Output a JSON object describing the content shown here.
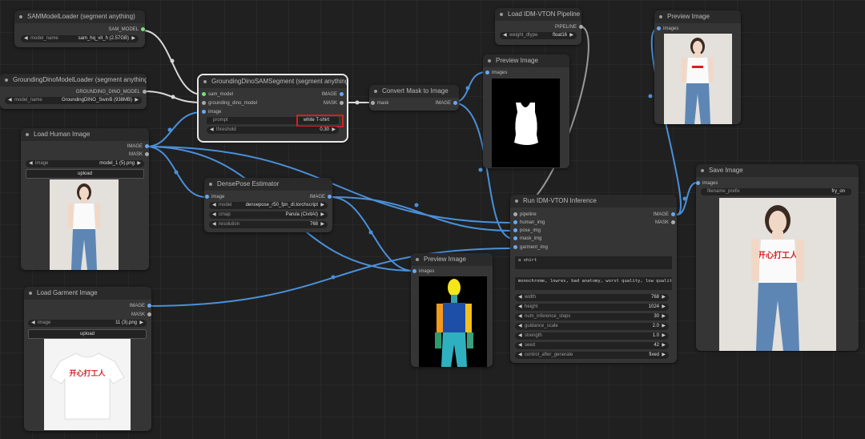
{
  "nodes": {
    "sam_loader": {
      "title": "SAMModelLoader (segment anything)",
      "out_label": "SAM_MODEL",
      "widget_label": "model_name",
      "widget_value": "sam_hq_vit_h (2.57GB)"
    },
    "gdino_loader": {
      "title": "GroundingDinoModelLoader (segment anything)",
      "out_label": "GROUNDING_DINO_MODEL",
      "widget_label": "model_name",
      "widget_value": "GroundingDINO_SwinB (938MB)"
    },
    "gdino_seg": {
      "title": "GroundingDinoSAMSegment (segment anything)",
      "in1": "sam_model",
      "in2": "grounding_dino_model",
      "in3": "image",
      "out1": "IMAGE",
      "out2": "MASK",
      "prompt_label": "prompt",
      "prompt_value": "white T-shirt",
      "threshold_label": "threshold",
      "threshold_value": "0.30"
    },
    "convert_mask": {
      "title": "Convert Mask to Image",
      "in1": "mask",
      "out1": "IMAGE"
    },
    "load_idm": {
      "title": "Load IDM-VTON Pipeline",
      "out1": "PIPELINE",
      "widget_label": "weight_dtype",
      "widget_value": "float16"
    },
    "preview1": {
      "title": "Preview Image",
      "in1": "images"
    },
    "preview_top": {
      "title": "Preview Image",
      "in1": "images"
    },
    "load_human": {
      "title": "Load Human Image",
      "out1": "IMAGE",
      "out2": "MASK",
      "widget_label": "image",
      "widget_value": "model_1 (5).png",
      "upload_label": "upload"
    },
    "densepose": {
      "title": "DensePose Estimator",
      "in1": "image",
      "out1": "IMAGE",
      "w1_label": "model",
      "w1_value": "densepose_r50_fpn_dl.torchscript",
      "w2_label": "cmap",
      "w2_value": "Parula (CivitAI)",
      "w3_label": "resolution",
      "w3_value": "768"
    },
    "run_idm": {
      "title": "Run IDM-VTON Inference",
      "in1": "pipeline",
      "in2": "human_img",
      "in3": "pose_img",
      "in4": "mask_img",
      "in5": "garment_img",
      "out1": "IMAGE",
      "out2": "MASK",
      "text1": "a shirt",
      "text2": "monochrome, lowres, bad anatomy, worst quality, low quality",
      "widgets": [
        {
          "label": "width",
          "value": "768"
        },
        {
          "label": "height",
          "value": "1024"
        },
        {
          "label": "num_inference_steps",
          "value": "30"
        },
        {
          "label": "guidance_scale",
          "value": "2.0"
        },
        {
          "label": "strength",
          "value": "1.0"
        },
        {
          "label": "seed",
          "value": "42"
        },
        {
          "label": "control_after_generate",
          "value": "fixed"
        }
      ]
    },
    "save_image": {
      "title": "Save Image",
      "in1": "images",
      "widget_label": "filename_prefix",
      "widget_value": "fry_on"
    },
    "preview_pose": {
      "title": "Preview Image",
      "in1": "images"
    },
    "load_garment": {
      "title": "Load Garment Image",
      "out1": "IMAGE",
      "out2": "MASK",
      "widget_label": "image",
      "widget_value": "11 (3).png",
      "upload_label": "upload"
    }
  },
  "garment_text": "开心打工人",
  "colors": {
    "wire_image": "#4a90d9",
    "wire_other": "#d8d8d8",
    "highlight": "#d42020"
  }
}
